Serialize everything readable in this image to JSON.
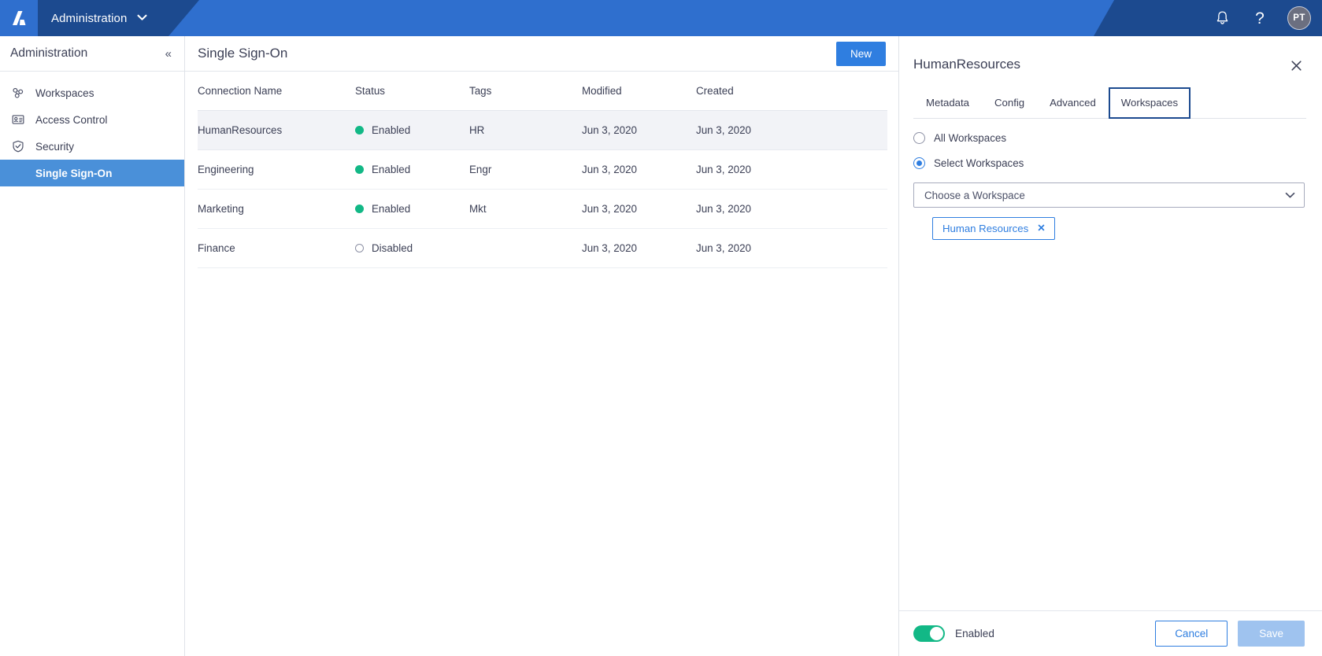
{
  "topbar": {
    "logo_alt": "app-logo",
    "nav_title": "Administration",
    "caret": "⌄",
    "notifications_icon": "bell-icon",
    "help_label": "?",
    "avatar_initials": "PT",
    "bg_light": "#2f6fce",
    "bg_dark": "#1c4a8f"
  },
  "sidebar": {
    "title": "Administration",
    "collapse_label": "«",
    "items": [
      {
        "label": "Workspaces",
        "icon": "workspaces-icon"
      },
      {
        "label": "Access Control",
        "icon": "access-control-icon"
      },
      {
        "label": "Security",
        "icon": "shield-check-icon"
      }
    ],
    "sub_items": [
      {
        "label": "Single Sign-On",
        "active": true
      }
    ],
    "active_bg": "#4a90d9"
  },
  "page": {
    "title": "Single Sign-On",
    "new_button": "New"
  },
  "table": {
    "columns": [
      "Connection Name",
      "Status",
      "Tags",
      "Modified",
      "Created"
    ],
    "rows": [
      {
        "name": "HumanResources",
        "status": "Enabled",
        "enabled": true,
        "tags": "HR",
        "modified": "Jun 3, 2020",
        "created": "Jun 3, 2020",
        "selected": true
      },
      {
        "name": "Engineering",
        "status": "Enabled",
        "enabled": true,
        "tags": "Engr",
        "modified": "Jun 3, 2020",
        "created": "Jun 3, 2020",
        "selected": false
      },
      {
        "name": "Marketing",
        "status": "Enabled",
        "enabled": true,
        "tags": "Mkt",
        "modified": "Jun 3, 2020",
        "created": "Jun 3, 2020",
        "selected": false
      },
      {
        "name": "Finance",
        "status": "Disabled",
        "enabled": false,
        "tags": "",
        "modified": "Jun 3, 2020",
        "created": "Jun 3, 2020",
        "selected": false
      }
    ],
    "status_on_color": "#12b886",
    "status_off_color": "#8c90a4",
    "selected_row_bg": "#f2f3f7"
  },
  "panel": {
    "title": "HumanResources",
    "close_icon": "close-icon",
    "tabs": [
      {
        "label": "Metadata",
        "focused": false
      },
      {
        "label": "Config",
        "focused": false
      },
      {
        "label": "Advanced",
        "focused": false
      },
      {
        "label": "Workspaces",
        "focused": true
      }
    ],
    "focus_ring_color": "#1c4a8f",
    "radios": [
      {
        "label": "All Workspaces",
        "checked": false
      },
      {
        "label": "Select Workspaces",
        "checked": true
      }
    ],
    "workspace_select": {
      "placeholder": "Choose a Workspace",
      "value": "",
      "chevron_icon": "chevron-down-icon"
    },
    "chips": [
      {
        "label": "Human Resources",
        "remove_label": "✕"
      }
    ],
    "chip_color": "#2f7ee0",
    "footer": {
      "toggle_state": true,
      "toggle_label": "Enabled",
      "cancel_label": "Cancel",
      "save_label": "Save",
      "save_disabled": true
    }
  }
}
